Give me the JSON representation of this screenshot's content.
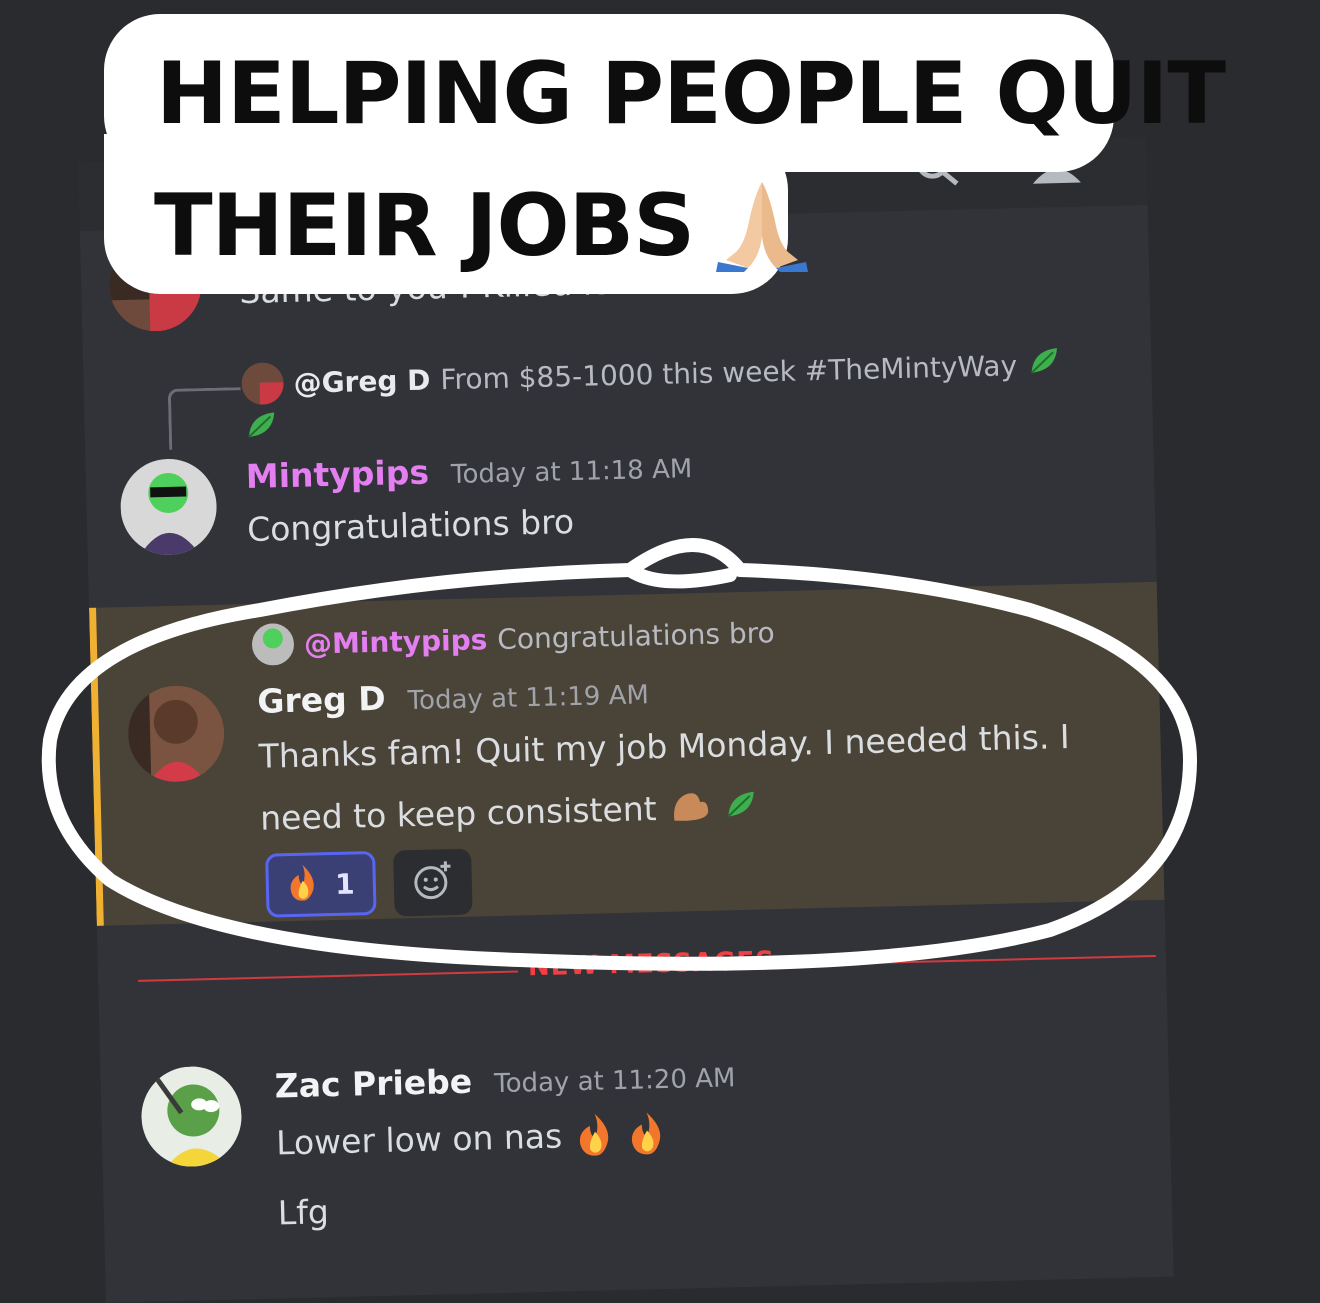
{
  "caption": {
    "line1": "HELPING PEOPLE QUIT",
    "line2": "THEIR JOBS"
  },
  "colors": {
    "mintypips_name": "#e37ff0",
    "highlight_bg": "#4a4338",
    "mention_bar": "#f0b132",
    "new_messages": "#f23f43"
  },
  "messages": [
    {
      "id": "prev",
      "text": "Same to you ! Killed it !"
    },
    {
      "id": "mintypips",
      "reply": {
        "mention": "@Greg D",
        "text": "From $85-1000 this week #TheMintyWay"
      },
      "username": "Mintypips",
      "timestamp": "Today at 11:18 AM",
      "text": "Congratulations bro"
    },
    {
      "id": "gregd",
      "reply": {
        "mention": "@Mintypips",
        "text": "Congratulations bro"
      },
      "username": "Greg D",
      "timestamp": "Today at 11:19 AM",
      "text_line1": "Thanks fam! Quit my job Monday. I needed this. I",
      "text_line2": "need to keep consistent",
      "reaction": {
        "emoji": "fire",
        "count": "1"
      }
    },
    {
      "id": "zac",
      "username": "Zac Priebe",
      "timestamp": "Today at 11:20 AM",
      "text1": "Lower low on nas",
      "text2": "Lfg"
    }
  ],
  "divider": {
    "label": "NEW MESSAGES"
  },
  "icons": {
    "topbar": [
      "search-icon",
      "members-icon"
    ],
    "caption_emoji": "praying-hands-icon",
    "leaf": "leaf-icon",
    "muscle": "flexed-biceps-icon",
    "reaction": "fire-icon",
    "add_reaction": "add-reaction-icon"
  }
}
